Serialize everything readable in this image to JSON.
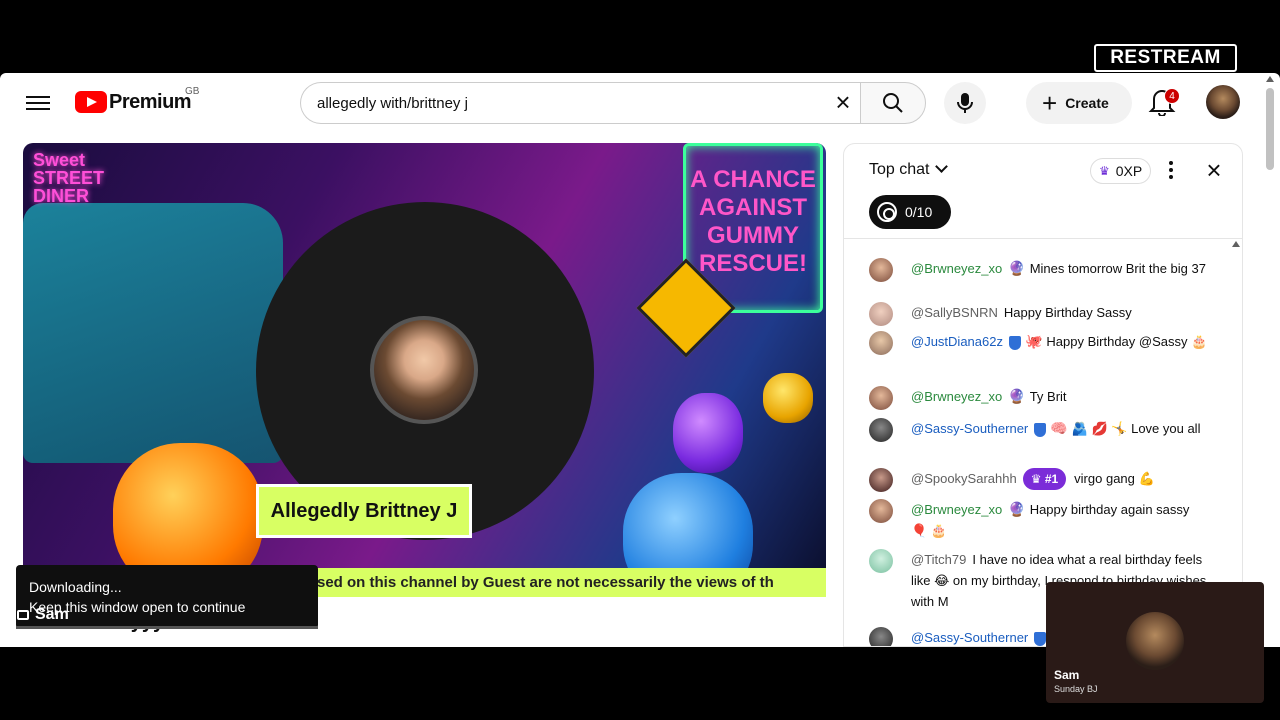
{
  "restream": {
    "logo_text": "RESTREAM"
  },
  "header": {
    "logo_text": "Premium",
    "region": "GB",
    "search_value": "allegedly with/brittney j",
    "create_label": "Create",
    "notification_count": "4"
  },
  "video": {
    "sign_left": "Sweet STREET DINER",
    "sign_right": "A CHANCE AGAINST GUMMY RESCUE!",
    "guest_name": "Allegedly Brittney J",
    "ticker": "sed on this channel by Guest are not necessarily the views of th",
    "title_fragment": "on a Sundayyy."
  },
  "toast": {
    "line1": "Downloading...",
    "line2": "Keep this window open to continue"
  },
  "camera_label": "Sam",
  "chat": {
    "title": "Top chat",
    "xp": "0XP",
    "goal": "0/10",
    "messages": [
      {
        "author": "@Brwneyez_xo",
        "emoji": "🔮",
        "text": "Mines tomorrow Brit the big 37",
        "color": "green"
      },
      {
        "author": "@SallyBSNRN",
        "emoji": "",
        "text": "Happy Birthday Sassy",
        "color": "gray"
      },
      {
        "author": "@JustDiana62z",
        "emoji": "🐙",
        "text": "Happy Birthday @Sassy 🎂",
        "color": "blue"
      },
      {
        "author": "@Brwneyez_xo",
        "emoji": "🔮",
        "text": "Ty Brit",
        "color": "green"
      },
      {
        "author": "@Sassy-Southerner",
        "emoji": "🧠",
        "text": "🫂 💋 🤸 Love you all",
        "color": "blue"
      },
      {
        "author": "@SpookySarahhh",
        "rank": "#1",
        "text": "virgo gang 💪",
        "color": "gray"
      },
      {
        "author": "@Brwneyez_xo",
        "emoji": "🔮",
        "text": "Happy birthday again sassy 🎈 🎂",
        "color": "green"
      },
      {
        "author": "@Titch79",
        "emoji": "",
        "text": "I have no idea what a real birthday feels like 😂 on my birthday, I respond to birthday wishes with M",
        "color": "gray"
      },
      {
        "author": "@Sassy-Southerner",
        "emoji": "",
        "text": "",
        "color": "blue"
      }
    ]
  },
  "pip": {
    "name": "Sam",
    "subtitle": "Sunday BJ"
  }
}
